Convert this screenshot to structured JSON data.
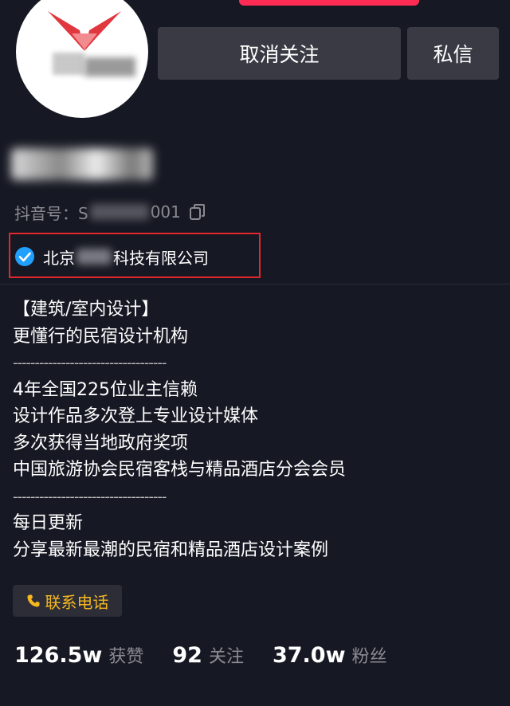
{
  "profile": {
    "nickname": "设计",
    "douyin_id_prefix": "抖音号：S",
    "douyin_id_suffix": "001",
    "company_prefix": "北京",
    "company_suffix": "科技有限公司"
  },
  "actions": {
    "unfollow_label": "取消关注",
    "message_label": "私信"
  },
  "bio": {
    "lines": [
      "【建筑/室内设计】",
      "更懂行的民宿设计机构",
      "-----------------------------------",
      "4年全国225位业主信赖",
      "设计作品多次登上专业设计媒体",
      "多次获得当地政府奖项",
      "中国旅游协会民宿客栈与精品酒店分会会员",
      "-----------------------------------",
      "每日更新",
      "分享最新最潮的民宿和精品酒店设计案例"
    ]
  },
  "contact": {
    "label": "联系电话"
  },
  "stats": {
    "likes_count": "126.5w",
    "likes_label": "获赞",
    "following_count": "92",
    "following_label": "关注",
    "followers_count": "37.0w",
    "followers_label": "粉丝"
  },
  "colors": {
    "background": "#161823",
    "button": "#3a3a44",
    "accent_red": "#fe2c55",
    "highlight_box": "#e4272d",
    "verified_blue": "#20a0ff",
    "contact_gold": "#f5b820",
    "muted_text": "#8a8b91"
  },
  "icons": {
    "verified": "verified-badge-icon",
    "copy": "copy-icon",
    "phone": "phone-icon"
  }
}
